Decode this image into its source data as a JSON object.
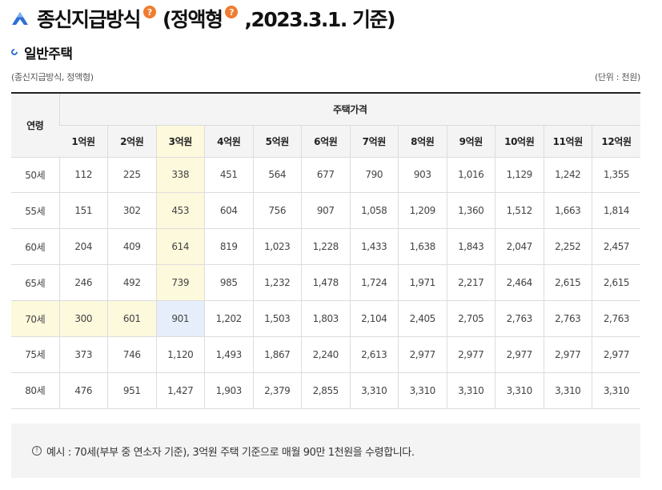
{
  "header": {
    "title_main": "종신지급방식",
    "help_glyph": "?",
    "title_second": "(정액형",
    "title_third": ",2023.3.1. 기준)",
    "logo_icon": "mountain-logo-icon",
    "accent_color": "#2f6fd6",
    "help_color": "#f07c2f"
  },
  "section": {
    "title": "일반주택",
    "caption_left": "(종신지급방식, 정액형)",
    "caption_right": "(단위 : 천원)"
  },
  "table": {
    "age_header": "연령",
    "price_header": "주택가격",
    "columns": [
      "1억원",
      "2억원",
      "3억원",
      "4억원",
      "5억원",
      "6억원",
      "7억원",
      "8억원",
      "9억원",
      "10억원",
      "11억원",
      "12억원"
    ],
    "rows": [
      {
        "age": "50세",
        "values": [
          "112",
          "225",
          "338",
          "451",
          "564",
          "677",
          "790",
          "903",
          "1,016",
          "1,129",
          "1,242",
          "1,355"
        ]
      },
      {
        "age": "55세",
        "values": [
          "151",
          "302",
          "453",
          "604",
          "756",
          "907",
          "1,058",
          "1,209",
          "1,360",
          "1,512",
          "1,663",
          "1,814"
        ]
      },
      {
        "age": "60세",
        "values": [
          "204",
          "409",
          "614",
          "819",
          "1,023",
          "1,228",
          "1,433",
          "1,638",
          "1,843",
          "2,047",
          "2,252",
          "2,457"
        ]
      },
      {
        "age": "65세",
        "values": [
          "246",
          "492",
          "739",
          "985",
          "1,232",
          "1,478",
          "1,724",
          "1,971",
          "2,217",
          "2,464",
          "2,615",
          "2,615"
        ]
      },
      {
        "age": "70세",
        "values": [
          "300",
          "601",
          "901",
          "1,202",
          "1,503",
          "1,803",
          "2,104",
          "2,405",
          "2,705",
          "2,763",
          "2,763",
          "2,763"
        ]
      },
      {
        "age": "75세",
        "values": [
          "373",
          "746",
          "1,120",
          "1,493",
          "1,867",
          "2,240",
          "2,613",
          "2,977",
          "2,977",
          "2,977",
          "2,977",
          "2,977"
        ]
      },
      {
        "age": "80세",
        "values": [
          "476",
          "951",
          "1,427",
          "1,903",
          "2,379",
          "2,855",
          "3,310",
          "3,310",
          "3,310",
          "3,310",
          "3,310",
          "3,310"
        ]
      }
    ],
    "highlight_yellow": "#fdf9dd",
    "highlight_blue": "#e6eefb"
  },
  "note": {
    "icon_glyph": "!",
    "text": "예시 : 70세(부부 중 연소자 기준), 3억원 주택 기준으로 매월 90만 1천원을 수령합니다."
  }
}
